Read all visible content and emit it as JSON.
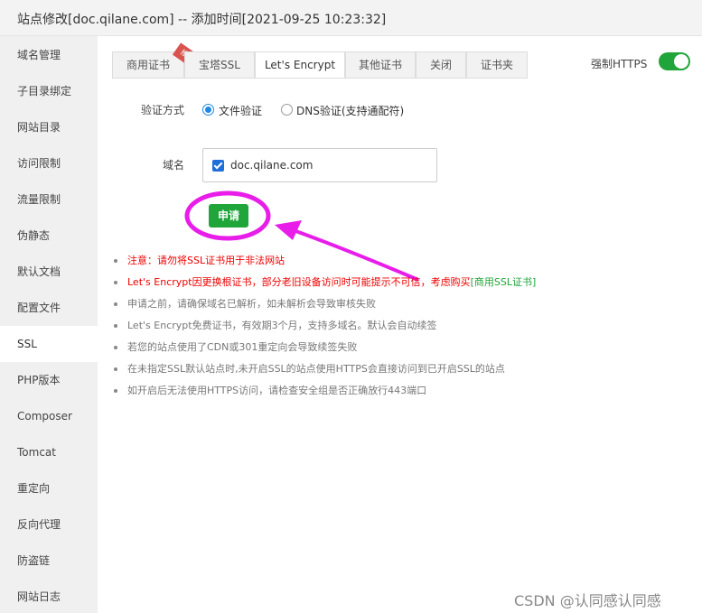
{
  "window": {
    "title": "站点修改[doc.qilane.com] -- 添加时间[2021-09-25 10:23:32]"
  },
  "sidebar": {
    "items": [
      {
        "label": "域名管理"
      },
      {
        "label": "子目录绑定"
      },
      {
        "label": "网站目录"
      },
      {
        "label": "访问限制"
      },
      {
        "label": "流量限制"
      },
      {
        "label": "伪静态"
      },
      {
        "label": "默认文档"
      },
      {
        "label": "配置文件"
      },
      {
        "label": "SSL"
      },
      {
        "label": "PHP版本"
      },
      {
        "label": "Composer"
      },
      {
        "label": "Tomcat"
      },
      {
        "label": "重定向"
      },
      {
        "label": "反向代理"
      },
      {
        "label": "防盗链"
      },
      {
        "label": "网站日志"
      }
    ],
    "active": "SSL"
  },
  "tabs": {
    "items": [
      {
        "label": "商用证书"
      },
      {
        "label": "宝塔SSL"
      },
      {
        "label": "Let's Encrypt"
      },
      {
        "label": "其他证书"
      },
      {
        "label": "关闭"
      },
      {
        "label": "证书夹"
      }
    ],
    "active": "Let's Encrypt",
    "badge": "推荐"
  },
  "force_https": {
    "label": "强制HTTPS",
    "enabled": true
  },
  "form": {
    "verify_label": "验证方式",
    "options": [
      {
        "label": "文件验证",
        "checked": true
      },
      {
        "label": "DNS验证(支持通配符)",
        "checked": false
      }
    ],
    "domain_label": "域名",
    "domain_value": "doc.qilane.com",
    "domain_checked": true,
    "apply_label": "申请"
  },
  "notes": {
    "n1": "注意：请勿将SSL证书用于非法网站",
    "n2_text": "Let's Encrypt因更换根证书，部分老旧设备访问时可能提示不可信，考虑购买",
    "n2_link": "[商用SSL证书]",
    "n3": "申请之前，请确保域名已解析，如未解析会导致审核失败",
    "n4": "Let's Encrypt免费证书，有效期3个月，支持多域名。默认会自动续签",
    "n5": "若您的站点使用了CDN或301重定向会导致续签失败",
    "n6": "在未指定SSL默认站点时,未开启SSL的站点使用HTTPS会直接访问到已开启SSL的站点",
    "n7": "如开启后无法使用HTTPS访问，请检查安全组是否正确放行443端口"
  },
  "colors": {
    "accent_green": "#20a53a",
    "warning_red": "#e00000",
    "annotation_magenta": "#e91de9",
    "radio_blue": "#1e88e5"
  },
  "watermark": "CSDN @认同感认同感"
}
